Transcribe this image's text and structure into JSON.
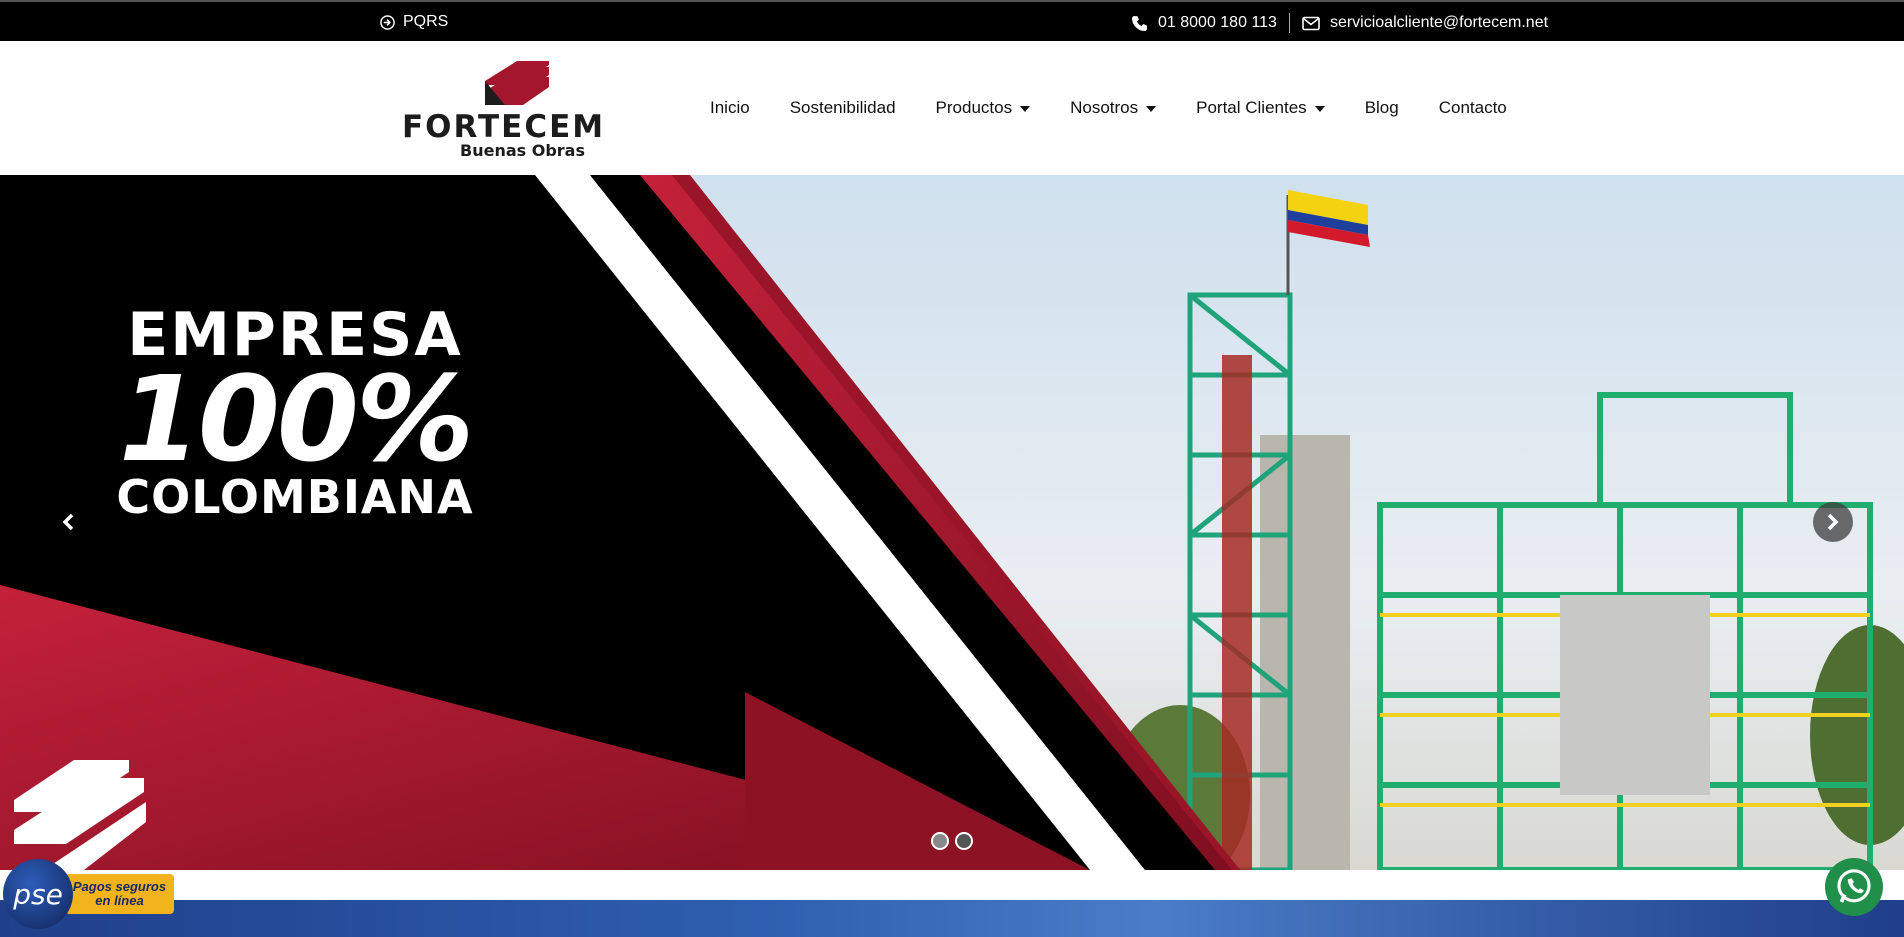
{
  "topbar": {
    "pqrs_label": "PQRS",
    "phone": "01 8000 180 113",
    "email": "servicioalcliente@fortecem.net"
  },
  "logo": {
    "brand": "FORTECEM",
    "tagline": "Buenas Obras"
  },
  "nav": {
    "items": [
      {
        "label": "Inicio",
        "dropdown": false
      },
      {
        "label": "Sostenibilidad",
        "dropdown": false
      },
      {
        "label": "Productos",
        "dropdown": true
      },
      {
        "label": "Nosotros",
        "dropdown": true
      },
      {
        "label": "Portal Clientes",
        "dropdown": true
      },
      {
        "label": "Blog",
        "dropdown": false
      },
      {
        "label": "Contacto",
        "dropdown": false
      }
    ]
  },
  "hero": {
    "line1": "EMPRESA",
    "line2": "100%",
    "line3": "COLOMBIANA",
    "slide_count": 2,
    "active_slide": 2
  },
  "pse": {
    "logo_text": "pse",
    "badge_text": "Pagos seguros en línea"
  },
  "colors": {
    "brand_red": "#a3162c",
    "topbar_bg": "#000000",
    "whatsapp_green": "#1f8f4a"
  }
}
